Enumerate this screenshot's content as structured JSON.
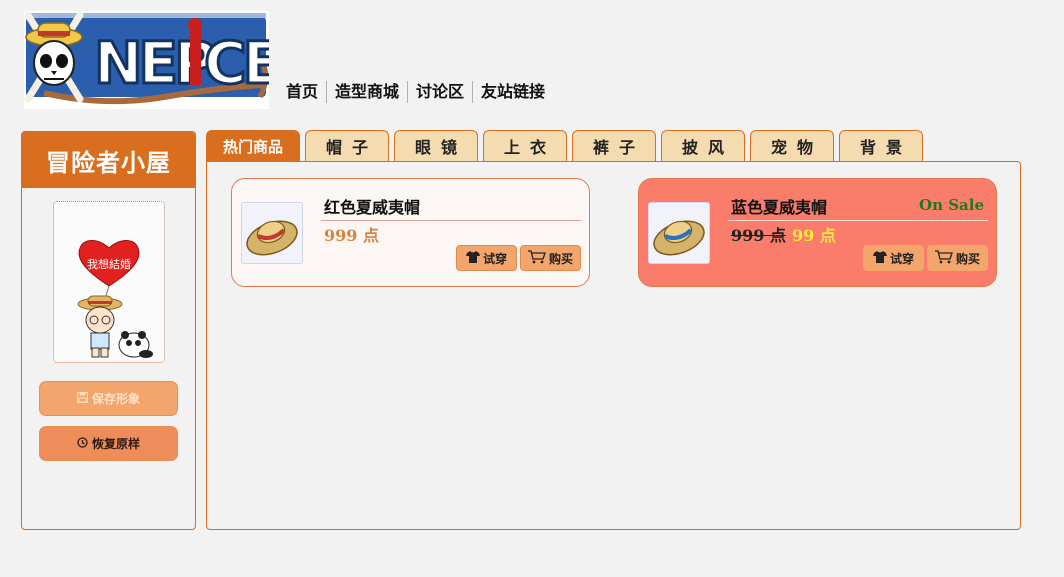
{
  "header": {
    "logo_text": "ONE PIECE",
    "nav": [
      "首页",
      "造型商城",
      "讨论区",
      "友站链接"
    ]
  },
  "sidebar": {
    "title": "冒险者小屋",
    "avatar_heart_text": "我想結婚",
    "save_button": "保存形象",
    "restore_button": "恢复原样",
    "save_icon": "floppy-disk-icon",
    "restore_icon": "history-icon"
  },
  "tabs": [
    "热门商品",
    "帽子",
    "眼镜",
    "上衣",
    "裤子",
    "披风",
    "宠物",
    "背景"
  ],
  "active_tab": 0,
  "products": [
    {
      "name": "红色夏威夷帽",
      "price": "999 点",
      "on_sale": false,
      "try_label": "试穿",
      "buy_label": "购买",
      "band_color": "#c0392b"
    },
    {
      "name": "蓝色夏威夷帽",
      "old_price": "999 点",
      "sale_price": "99 点",
      "sale_badge": "On Sale",
      "on_sale": true,
      "try_label": "试穿",
      "buy_label": "购买",
      "band_color": "#2a6fc0"
    }
  ],
  "colors": {
    "accent": "#d86e1e",
    "sale_card": "#fa7d6b",
    "tab_bg": "#f5dcb0",
    "sale_badge": "#1f7a1a",
    "sale_price": "#ffeb3b"
  }
}
